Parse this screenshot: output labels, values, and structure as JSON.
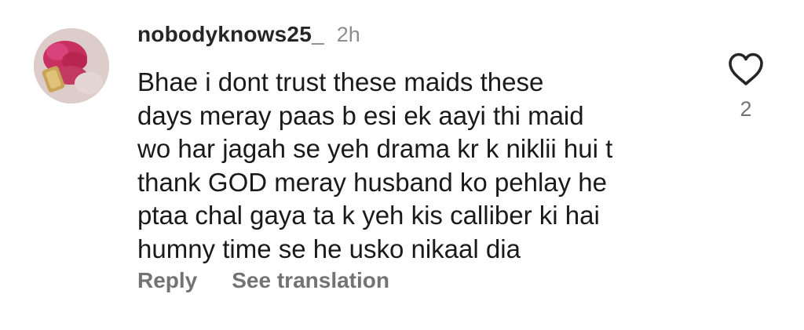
{
  "comment": {
    "username": "nobodyknows25_",
    "time": "2h",
    "text_lines": [
      "Bhae i dont trust these maids these",
      "days meray paas b esi ek aayi thi maid",
      "wo har jagah se yeh drama kr k niklii hui t",
      "thank GOD meray husband ko pehlay he",
      "ptaa chal gaya ta k yeh kis calliber ki hai",
      "humny time se he usko nikaal dia"
    ],
    "actions": {
      "reply": "Reply",
      "see_translation": "See translation"
    },
    "likes": {
      "icon": "heart-outline-icon",
      "count": "2"
    }
  },
  "colors": {
    "username": "#262626",
    "secondary": "#8e8e8e",
    "action": "#737373",
    "body": "#1a1a1a"
  }
}
